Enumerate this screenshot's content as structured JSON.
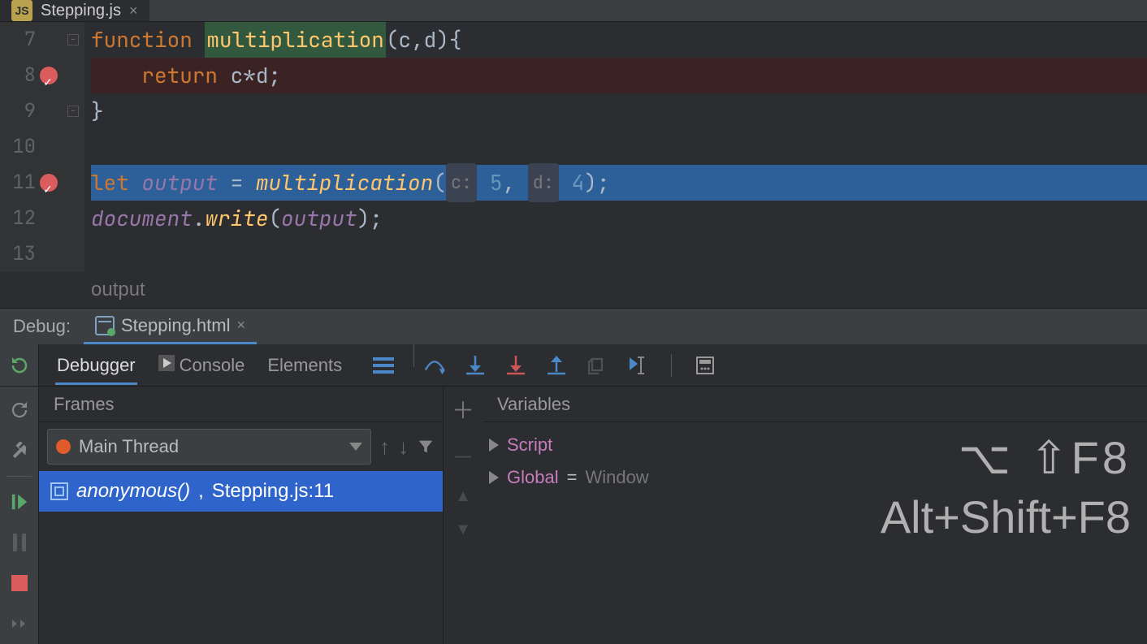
{
  "file_tab": {
    "name": "Stepping.js"
  },
  "editor": {
    "lines": [
      7,
      8,
      9,
      10,
      11,
      12,
      13
    ],
    "breakpoints": [
      8,
      11
    ],
    "code": {
      "l7": {
        "kw": "function",
        "name": "multiplication",
        "params": "(c,d){"
      },
      "l8": {
        "kw": "return",
        "expr": " c*d;"
      },
      "l9": {
        "brace": "}"
      },
      "l11": {
        "kw": "let",
        "var": "output",
        "eq": " = ",
        "call": "multiplication",
        "open": "(",
        "p1label": "c:",
        "p1val": " 5",
        "comma": ", ",
        "p2label": "d:",
        "p2val": " 4",
        "close": ");"
      },
      "l12": {
        "obj": "document",
        "dot": ".",
        "method": "write",
        "open": "(",
        "arg": "output",
        "close": ");"
      }
    },
    "context": "output"
  },
  "debug": {
    "label": "Debug:",
    "tab": "Stepping.html",
    "subtabs": {
      "debugger": "Debugger",
      "console": "Console",
      "elements": "Elements"
    },
    "frames": {
      "header": "Frames",
      "thread": "Main Thread",
      "stack_item": {
        "fn": "anonymous()",
        "loc": "Stepping.js:11"
      }
    },
    "vars": {
      "header": "Variables",
      "items": [
        {
          "name": "Script"
        },
        {
          "name": "Global",
          "eq": " = ",
          "val": "Window"
        }
      ]
    }
  },
  "shortcuts": {
    "mac": "⌥⇧F8",
    "win": "Alt+Shift+F8"
  }
}
